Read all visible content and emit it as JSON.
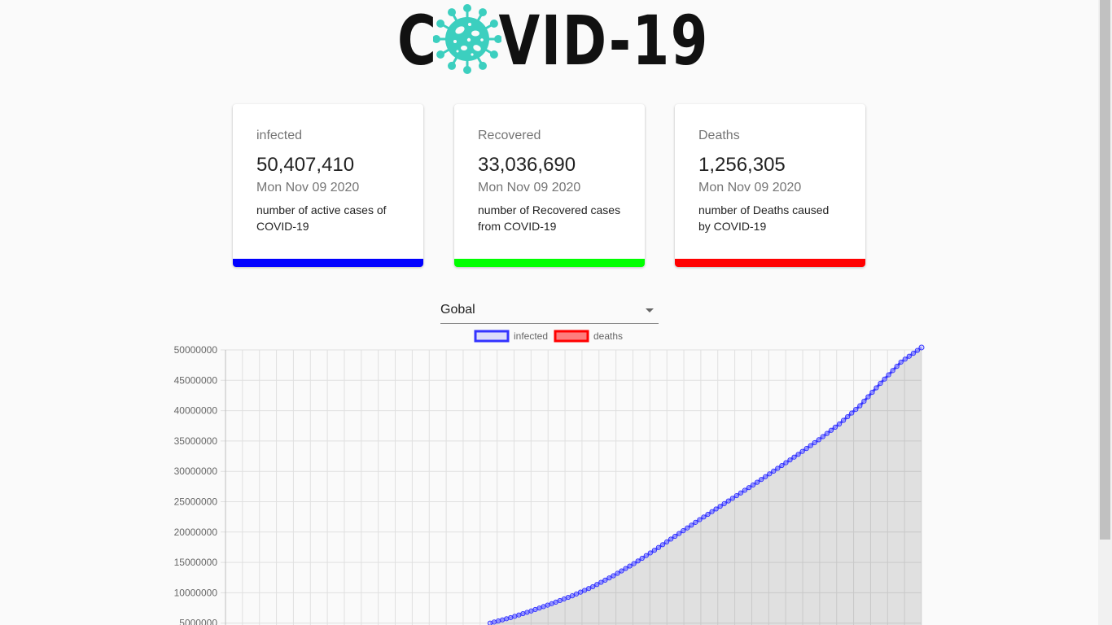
{
  "logo": {
    "text_before": "C",
    "text_after": "VID-19",
    "virus_color": "#3ccfbf"
  },
  "cards": [
    {
      "title": "infected",
      "value": "50,407,410",
      "date": "Mon Nov 09 2020",
      "description": "number of active cases of COVID-19",
      "color": "#0000ff"
    },
    {
      "title": "Recovered",
      "value": "33,036,690",
      "date": "Mon Nov 09 2020",
      "description": "number of Recovered cases from COVID-19",
      "color": "#00ff00"
    },
    {
      "title": "Deaths",
      "value": "1,256,305",
      "date": "Mon Nov 09 2020",
      "description": "number of Deaths caused by COVID-19",
      "color": "#ff0000"
    }
  ],
  "country_select": {
    "selected": "Gobal"
  },
  "chart_data": {
    "type": "line",
    "legend": [
      {
        "name": "infected",
        "border": "#3333ff",
        "fill": "rgba(0,0,255,0.12)"
      },
      {
        "name": "deaths",
        "border": "#ff0000",
        "fill": "rgba(255,0,0,0.5)"
      }
    ],
    "legend_position": "top",
    "grid": true,
    "y_ticks": [
      "50000000",
      "45000000",
      "40000000",
      "35000000",
      "30000000",
      "25000000",
      "20000000",
      "15000000",
      "10000000",
      "5000000"
    ],
    "ylim": [
      0,
      50000000
    ],
    "series": [
      {
        "name": "infected",
        "color": "#3333ff",
        "values": [
          5000000,
          5900000,
          7000000,
          8200000,
          9500000,
          11000000,
          12800000,
          14800000,
          17000000,
          19300000,
          21600000,
          23800000,
          26000000,
          28200000,
          30500000,
          32800000,
          35200000,
          37800000,
          40800000,
          44500000,
          48000000,
          50407410
        ]
      }
    ]
  }
}
